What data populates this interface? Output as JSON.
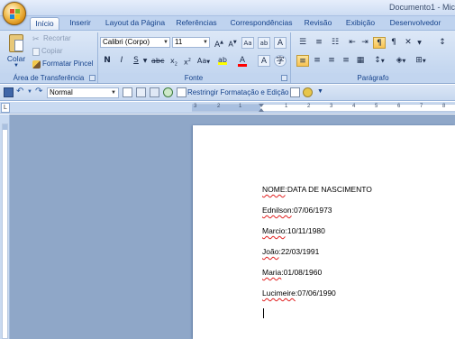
{
  "window": {
    "title": "Documento1 - Micro"
  },
  "tabs": [
    "Início",
    "Inserir",
    "Layout da Página",
    "Referências",
    "Correspondências",
    "Revisão",
    "Exibição",
    "Desenvolvedor"
  ],
  "clipboard": {
    "paste_label": "Colar",
    "cut_label": "Recortar",
    "copy_label": "Copiar",
    "format_painter_label": "Formatar Pincel",
    "group_label": "Área de Transferência"
  },
  "font": {
    "family": "Calibri (Corpo)",
    "size": "11",
    "group_label": "Fonte"
  },
  "paragraph": {
    "group_label": "Parágrafo"
  },
  "quick_access": {
    "style_value": "Normal",
    "restrict_label": "Restringir Formatação e Edição"
  },
  "ruler": {
    "numbers": [
      "3",
      "2",
      "1",
      "1",
      "2",
      "3",
      "4",
      "5",
      "6",
      "7",
      "8"
    ]
  },
  "document": {
    "lines": [
      {
        "name": "NOME",
        "sep": ":",
        "value": "DATA DE NASCIMENTO"
      },
      {
        "name": "Ednilson",
        "sep": ":",
        "value": "07/06/1973"
      },
      {
        "name": "Marcio",
        "sep": ":",
        "value": "10/11/1980"
      },
      {
        "name": "João",
        "sep": ":",
        "value": "22/03/1991"
      },
      {
        "name": "Maria",
        "sep": ":",
        "value": "01/08/1960"
      },
      {
        "name": "Lucimeire",
        "sep": ":",
        "value": "07/06/1990"
      }
    ]
  },
  "colors": {
    "ribbon_text": "#15428b",
    "workspace": "#8fa7c8",
    "spell_error": "#e02020",
    "highlight": "#ffff00",
    "font_color": "#ff0000"
  }
}
